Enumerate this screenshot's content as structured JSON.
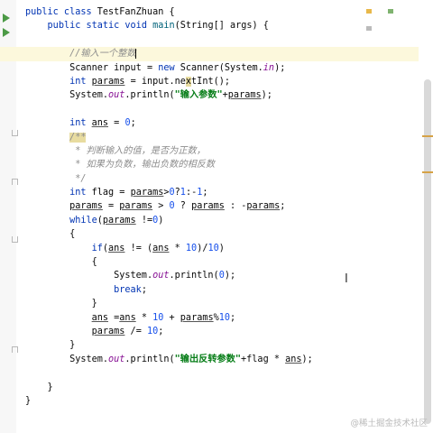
{
  "editor": {
    "watermark": "@稀土掘金技术社区",
    "colors": {
      "keyword": "#0033b3",
      "comment": "#8c8c8c",
      "string": "#067d17",
      "number": "#1750eb",
      "field": "#871094"
    }
  },
  "code": {
    "l1_a": "public class ",
    "l1_b": "TestFanZhuan {",
    "l2_a": "public static void ",
    "l2_b": "main",
    "l2_c": "(String[] args) {",
    "l4": "//输入一个整数",
    "l5_a": "Scanner input = ",
    "l5_b": "new ",
    "l5_c": "Scanner(System.",
    "l5_d": "in",
    "l5_e": ");",
    "l6_a": "int ",
    "l6_b": "params",
    "l6_c": " = input.ne",
    "l6_d": "x",
    "l6_e": "tInt();",
    "l7_a": "System.",
    "l7_b": "out",
    "l7_c": ".println(",
    "l7_d": "\"输入参数\"",
    "l7_e": "+",
    "l7_f": "params",
    "l7_g": ");",
    "l9_a": "int ",
    "l9_b": "ans",
    "l9_c": " = ",
    "l9_d": "0",
    "l9_e": ";",
    "l10": "/**",
    "l11": " * 判断输入的值，是否为正数，",
    "l12": " * 如果为负数，输出负数的相反数",
    "l13": " */",
    "l14_a": "int ",
    "l14_b": "flag = ",
    "l14_c": "params",
    "l14_d": ">",
    "l14_e": "0",
    "l14_f": "?",
    "l14_g": "1",
    "l14_h": ":-",
    "l14_i": "1",
    "l14_j": ";",
    "l15_a": "params",
    "l15_b": " = ",
    "l15_c": "params",
    "l15_d": " > ",
    "l15_e": "0",
    "l15_f": " ? ",
    "l15_g": "params",
    "l15_h": " : -",
    "l15_i": "params",
    "l15_j": ";",
    "l16_a": "while",
    "l16_b": "(",
    "l16_c": "params",
    "l16_d": " !=",
    "l16_e": "0",
    "l16_f": ")",
    "l17": "{",
    "l18_a": "if",
    "l18_b": "(",
    "l18_c": "ans",
    "l18_d": " != (",
    "l18_e": "ans",
    "l18_f": " * ",
    "l18_g": "10",
    "l18_h": ")/",
    "l18_i": "10",
    "l18_j": ")",
    "l19": "{",
    "l20_a": "System.",
    "l20_b": "out",
    "l20_c": ".println(",
    "l20_d": "0",
    "l20_e": ");",
    "l21_a": "break",
    "l21_b": ";",
    "l22": "}",
    "l23_a": "ans",
    "l23_b": " =",
    "l23_c": "ans",
    "l23_d": " * ",
    "l23_e": "10",
    "l23_f": " + ",
    "l23_g": "params",
    "l23_h": "%",
    "l23_i": "10",
    "l23_j": ";",
    "l24_a": "params",
    "l24_b": " /= ",
    "l24_c": "10",
    "l24_d": ";",
    "l25": "}",
    "l26_a": "System.",
    "l26_b": "out",
    "l26_c": ".println(",
    "l26_d": "\"输出反转参数\"",
    "l26_e": "+flag * ",
    "l26_f": "ans",
    "l26_g": ");",
    "l28": "}",
    "l29": "}"
  }
}
